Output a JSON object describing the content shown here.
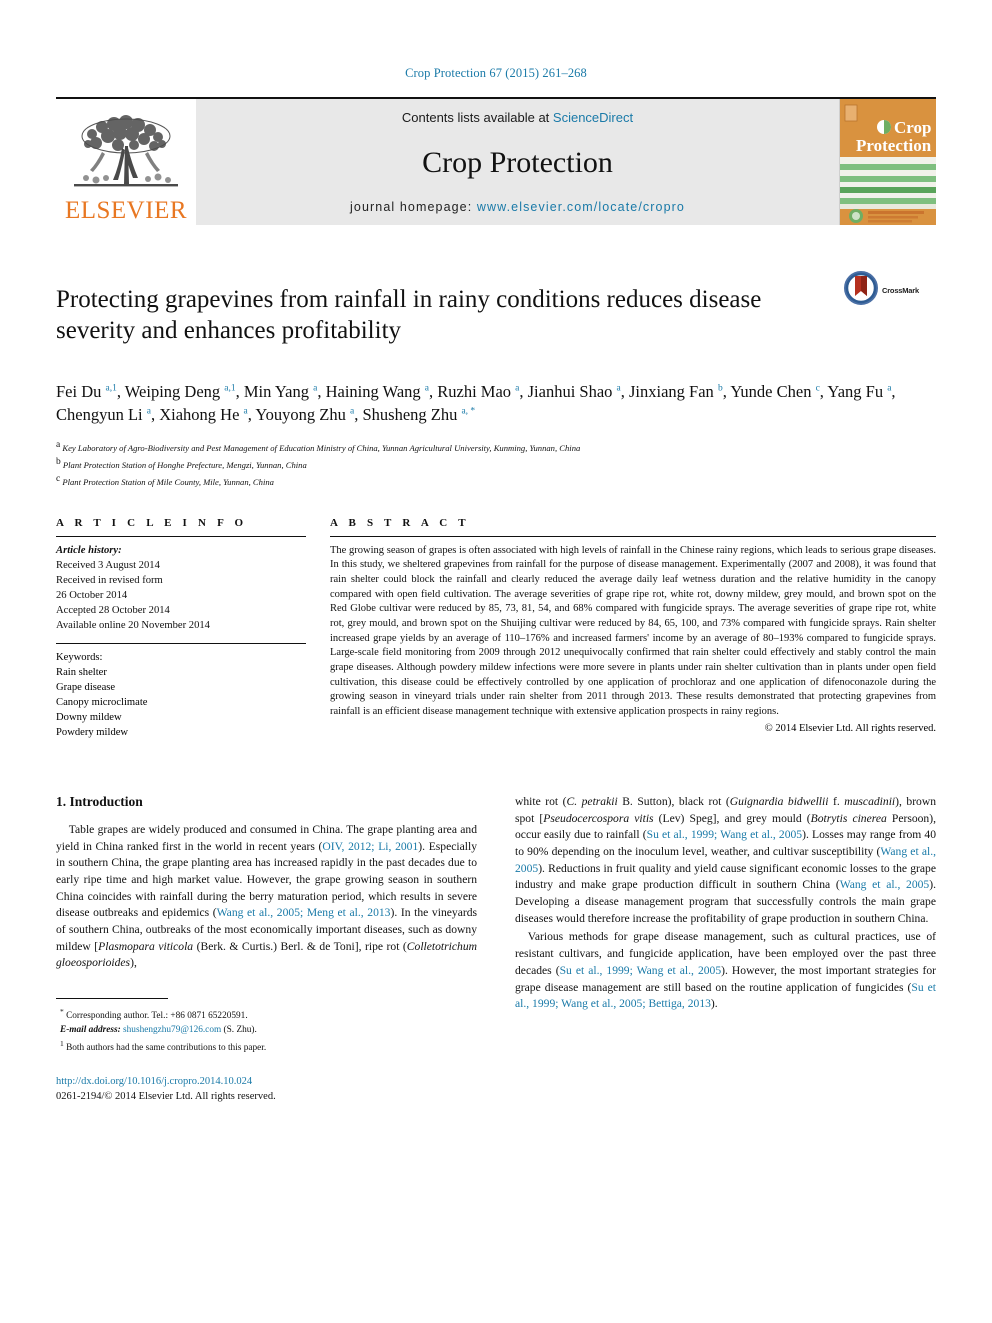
{
  "running_head": "Crop Protection 67 (2015) 261–268",
  "masthead": {
    "publisher_name": "ELSEVIER",
    "contents_prefix": "Contents lists available at ",
    "contents_link": "ScienceDirect",
    "journal_title": "Crop Protection",
    "homepage_prefix": "journal homepage: ",
    "homepage_url": "www.elsevier.com/locate/cropro",
    "cover_title_line1": "Crop",
    "cover_title_line2": "Protection",
    "accent_color": "#1a7aa8",
    "elsevier_orange": "#E87722",
    "cover_orange": "#d9923f",
    "cover_green": "#7fbf7f"
  },
  "article": {
    "title": "Protecting grapevines from rainfall in rainy conditions reduces disease severity and enhances profitability",
    "crossmark_label": "CrossMark",
    "authors_html": "Fei Du <sup>a,1</sup>, Weiping Deng <sup>a,1</sup>, Min Yang <sup>a</sup>, Haining Wang <sup>a</sup>, Ruzhi Mao <sup>a</sup>, Jianhui Shao <sup>a</sup>, Jinxiang Fan <sup>b</sup>, Yunde Chen <sup>c</sup>, Yang Fu <sup>a</sup>, Chengyun Li <sup>a</sup>, Xiahong He <sup>a</sup>, Youyong Zhu <sup>a</sup>, Shusheng Zhu <sup>a, *</sup>",
    "affiliations": [
      {
        "marker": "a",
        "text": "Key Laboratory of Agro-Biodiversity and Pest Management of Education Ministry of China, Yunnan Agricultural University, Kunming, Yunnan, China"
      },
      {
        "marker": "b",
        "text": "Plant Protection Station of Honghe Prefecture, Mengzi, Yunnan, China"
      },
      {
        "marker": "c",
        "text": "Plant Protection Station of Mile County, Mile, Yunnan, China"
      }
    ]
  },
  "article_info": {
    "heading": "A R T I C L E  I N F O",
    "history_label": "Article history:",
    "history_lines": [
      "Received 3 August 2014",
      "Received in revised form",
      "26 October 2014",
      "Accepted 28 October 2014",
      "Available online 20 November 2014"
    ],
    "keywords_label": "Keywords:",
    "keywords": [
      "Rain shelter",
      "Grape disease",
      "Canopy microclimate",
      "Downy mildew",
      "Powdery mildew"
    ]
  },
  "abstract": {
    "heading": "A B S T R A C T",
    "text": "The growing season of grapes is often associated with high levels of rainfall in the Chinese rainy regions, which leads to serious grape diseases. In this study, we sheltered grapevines from rainfall for the purpose of disease management. Experimentally (2007 and 2008), it was found that rain shelter could block the rainfall and clearly reduced the average daily leaf wetness duration and the relative humidity in the canopy compared with open field cultivation. The average severities of grape ripe rot, white rot, downy mildew, grey mould, and brown spot on the Red Globe cultivar were reduced by 85, 73, 81, 54, and 68% compared with fungicide sprays. The average severities of grape ripe rot, white rot, grey mould, and brown spot on the Shuijing cultivar were reduced by 84, 65, 100, and 73% compared with fungicide sprays. Rain shelter increased grape yields by an average of 110–176% and increased farmers' income by an average of 80–193% compared to fungicide sprays. Large-scale field monitoring from 2009 through 2012 unequivocally confirmed that rain shelter could effectively and stably control the main grape diseases. Although powdery mildew infections were more severe in plants under rain shelter cultivation than in plants under open field cultivation, this disease could be effectively controlled by one application of prochloraz and one application of difenoconazole during the growing season in vineyard trials under rain shelter from 2011 through 2013. These results demonstrated that protecting grapevines from rainfall is an efficient disease management technique with extensive application prospects in rainy regions.",
    "copyright": "© 2014 Elsevier Ltd. All rights reserved."
  },
  "introduction": {
    "heading": "1.  Introduction",
    "left_paragraph_html": "Table grapes are widely produced and consumed in China. The grape planting area and yield in China ranked first in the world in recent years (<span class=\"ref\">OIV, 2012; Li, 2001</span>). Especially in southern China, the grape planting area has increased rapidly in the past decades due to early ripe time and high market value. However, the grape growing season in southern China coincides with rainfall during the berry maturation period, which results in severe disease outbreaks and epidemics (<span class=\"ref\">Wang et al., 2005; Meng et al., 2013</span>). In the vineyards of southern China, outbreaks of the most economically important diseases, such as downy mildew [<span class=\"sp\">Plasmopara viticola</span> (Berk. &amp; Curtis.) Berl. &amp; de Toni], ripe rot (<span class=\"sp\">Colletotrichum gloeosporioides</span>),",
    "right_paragraph1_html": "white rot (<span class=\"sp\">C. petrakii</span> B. Sutton), black rot (<span class=\"sp\">Guignardia bidwellii</span> f. <span class=\"sp\">muscadinii</span>), brown spot [<span class=\"sp\">Pseudocercospora vitis</span> (Lev) Speg], and grey mould (<span class=\"sp\">Botrytis cinerea</span> Persoon), occur easily due to rainfall (<span class=\"ref\">Su et al., 1999; Wang et al., 2005</span>). Losses may range from 40 to 90% depending on the inoculum level, weather, and cultivar susceptibility (<span class=\"ref\">Wang et al., 2005</span>). Reductions in fruit quality and yield cause significant economic losses to the grape industry and make grape production difficult in southern China (<span class=\"ref\">Wang et al., 2005</span>). Developing a disease management program that successfully controls the main grape diseases would therefore increase the profitability of grape production in southern China.",
    "right_paragraph2_html": "Various methods for grape disease management, such as cultural practices, use of resistant cultivars, and fungicide application, have been employed over the past three decades (<span class=\"ref\">Su et al., 1999; Wang et al., 2005</span>). However, the most important strategies for grape disease management are still based on the routine application of fungicides (<span class=\"ref\">Su et al., 1999; Wang et al., 2005; Bettiga, 2013</span>)."
  },
  "footnotes": {
    "corresponding_html": "<sup>*</sup> Corresponding author. Tel.: +86 0871 65220591.",
    "email_html": "<span class=\"em\">E-mail address:</span> <span class=\"link\">shushengzhu79@126.com</span> (S. Zhu).",
    "equal_contrib_html": "<sup>1</sup> Both authors had the same contributions to this paper.",
    "doi": "http://dx.doi.org/10.1016/j.cropro.2014.10.024",
    "issn_line": "0261-2194/© 2014 Elsevier Ltd. All rights reserved."
  }
}
